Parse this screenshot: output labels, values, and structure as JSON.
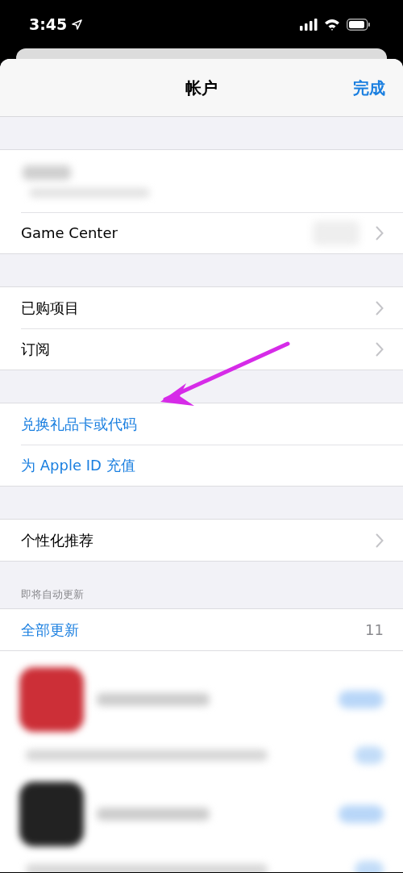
{
  "status_bar": {
    "time": "3:45"
  },
  "nav": {
    "title": "帐户",
    "done": "完成"
  },
  "sections": [
    {
      "rows": [
        {
          "kind": "account"
        },
        {
          "kind": "nav",
          "label": "Game Center",
          "redacted_value": true
        }
      ]
    },
    {
      "rows": [
        {
          "kind": "nav",
          "label": "已购项目"
        },
        {
          "kind": "nav",
          "label": "订阅"
        }
      ]
    },
    {
      "rows": [
        {
          "kind": "link",
          "label": "兑换礼品卡或代码"
        },
        {
          "kind": "link",
          "label": "为 Apple ID 充值"
        }
      ]
    },
    {
      "rows": [
        {
          "kind": "nav",
          "label": "个性化推荐"
        }
      ]
    },
    {
      "header": "即将自动更新",
      "rows": [
        {
          "kind": "count",
          "label": "全部更新",
          "value": "11"
        }
      ]
    }
  ],
  "updates": [
    {
      "color": "#cc2f37"
    },
    {
      "color": "#222222"
    }
  ],
  "annotation": {
    "kind": "arrow",
    "color": "#d62be8"
  }
}
